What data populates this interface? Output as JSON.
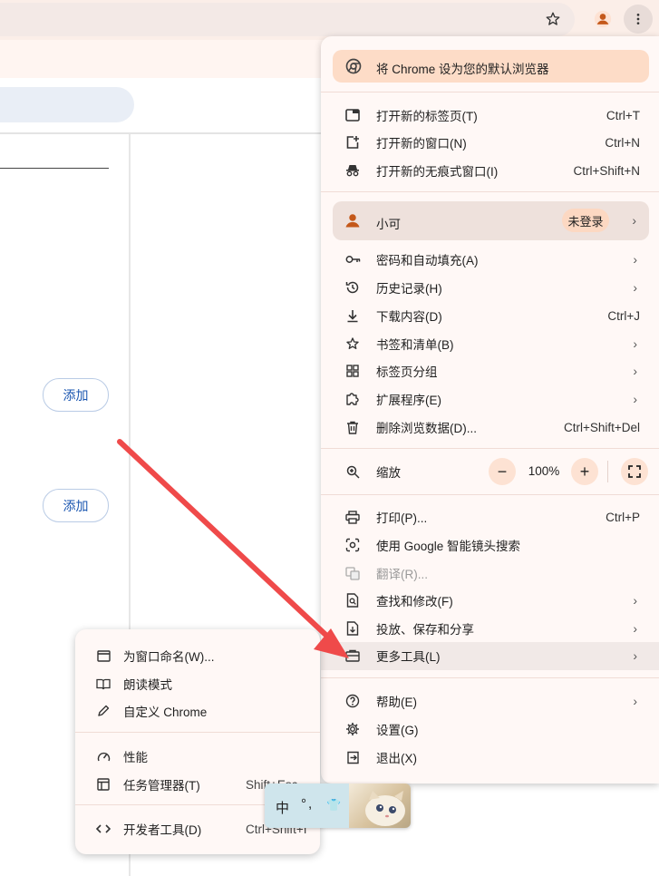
{
  "menu": {
    "default_banner": "将 Chrome 设为您的默认浏览器",
    "new_tab": {
      "label": "打开新的标签页(T)",
      "shortcut": "Ctrl+T"
    },
    "new_window": {
      "label": "打开新的窗口(N)",
      "shortcut": "Ctrl+N"
    },
    "incognito": {
      "label": "打开新的无痕式窗口(I)",
      "shortcut": "Ctrl+Shift+N"
    },
    "profile": {
      "name": "小可",
      "status": "未登录"
    },
    "passwords": {
      "label": "密码和自动填充(A)"
    },
    "history": {
      "label": "历史记录(H)"
    },
    "downloads": {
      "label": "下载内容(D)",
      "shortcut": "Ctrl+J"
    },
    "bookmarks": {
      "label": "书签和清单(B)"
    },
    "tab_groups": {
      "label": "标签页分组"
    },
    "extensions": {
      "label": "扩展程序(E)"
    },
    "clear_data": {
      "label": "删除浏览数据(D)...",
      "shortcut": "Ctrl+Shift+Del"
    },
    "zoom": {
      "label": "缩放",
      "minus": "−",
      "value": "100%",
      "plus": "+"
    },
    "print": {
      "label": "打印(P)...",
      "shortcut": "Ctrl+P"
    },
    "lens": {
      "label": "使用 Google 智能镜头搜索"
    },
    "translate": {
      "label": "翻译(R)..."
    },
    "find": {
      "label": "查找和修改(F)"
    },
    "cast": {
      "label": "投放、保存和分享"
    },
    "more_tools": {
      "label": "更多工具(L)"
    },
    "help": {
      "label": "帮助(E)"
    },
    "settings": {
      "label": "设置(G)"
    },
    "exit": {
      "label": "退出(X)"
    }
  },
  "submenu": {
    "name_window": {
      "label": "为窗口命名(W)..."
    },
    "reading_mode": {
      "label": "朗读模式"
    },
    "customize": {
      "label": "自定义 Chrome"
    },
    "performance": {
      "label": "性能"
    },
    "task_manager": {
      "label": "任务管理器(T)",
      "shortcut": "Shift+Esc"
    },
    "devtools": {
      "label": "开发者工具(D)",
      "shortcut": "Ctrl+Shift+I"
    }
  },
  "page": {
    "add_label_1": "添加",
    "add_label_2": "添加"
  },
  "ime": {
    "mode": "中",
    "punct": "°,",
    "shirt": "👕"
  },
  "colors": {
    "accent": "#c4581a",
    "arrow": "#ef4a4a",
    "banner": "#fddcc7"
  }
}
